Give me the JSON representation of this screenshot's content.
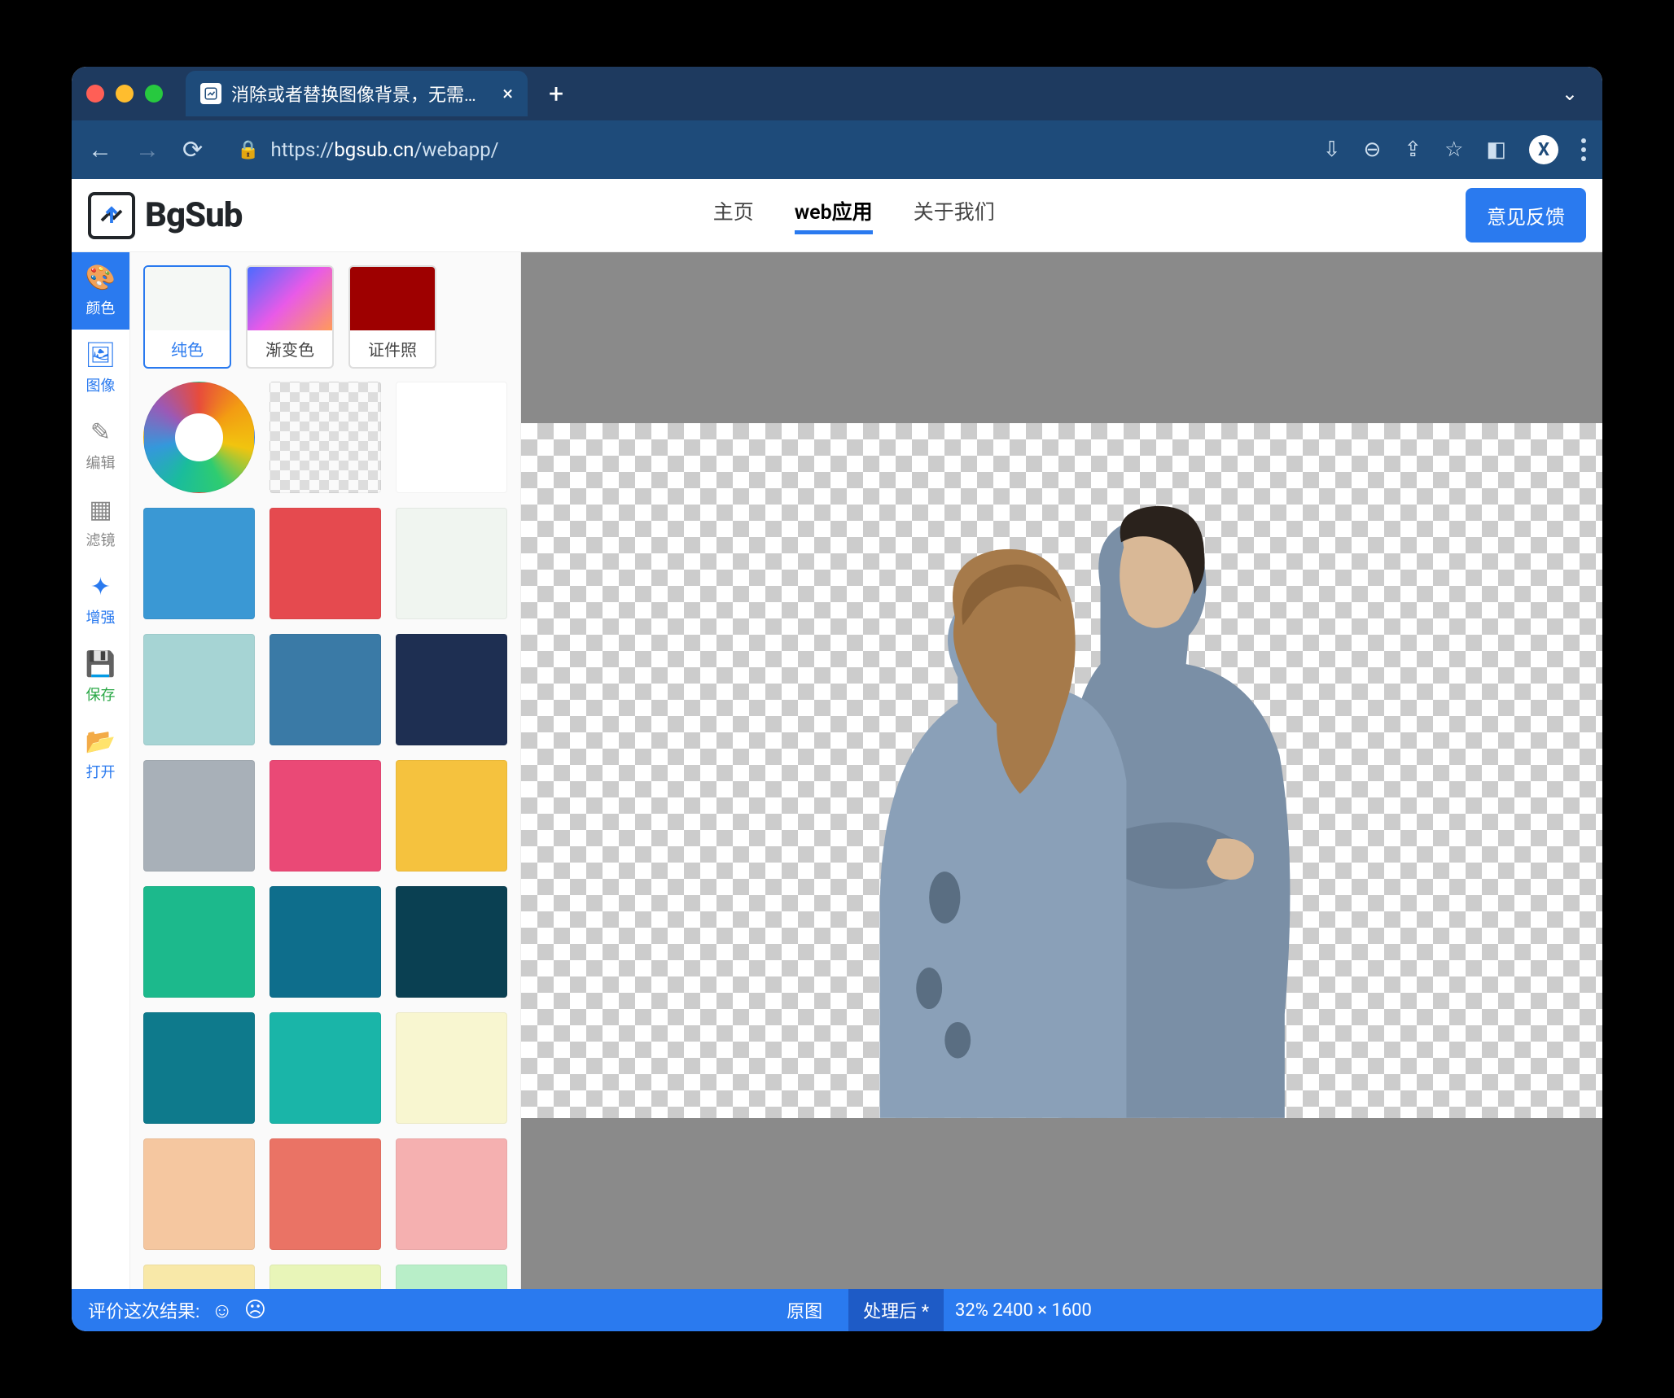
{
  "browser": {
    "tab_title": "消除或者替换图像背景，无需上传",
    "url_prefix": "https://",
    "url_domain": "bgsub.cn",
    "url_path": "/webapp/"
  },
  "header": {
    "logo_text": "BgSub",
    "nav": {
      "home": "主页",
      "webapp": "web应用",
      "about": "关于我们"
    },
    "feedback": "意见反馈"
  },
  "tools": {
    "color": "颜色",
    "image": "图像",
    "edit": "编辑",
    "filter": "滤镜",
    "enhance": "增强",
    "save": "保存",
    "open": "打开"
  },
  "color_tabs": {
    "solid": "纯色",
    "gradient": "渐变色",
    "id": "证件照"
  },
  "swatches": [
    "#3a98d4",
    "#e54a4f",
    "#f0f5f0",
    "#a6d4d4",
    "#3a7aa6",
    "#1e2f52",
    "#a8b0b8",
    "#ea4976",
    "#f5c23e",
    "#1cb98c",
    "#0e6e8c",
    "#0a4052",
    "#0e7a8c",
    "#1ab5a8",
    "#f8f6d0",
    "#f5c7a0",
    "#ea7365",
    "#f5b0b0",
    "#f8e8a8",
    "#e8f5b8",
    "#b8eec8"
  ],
  "status": {
    "rate_label": "评价这次结果:",
    "original": "原图",
    "processed": "处理后 *",
    "zoom_info": "32% 2400 × 1600"
  }
}
